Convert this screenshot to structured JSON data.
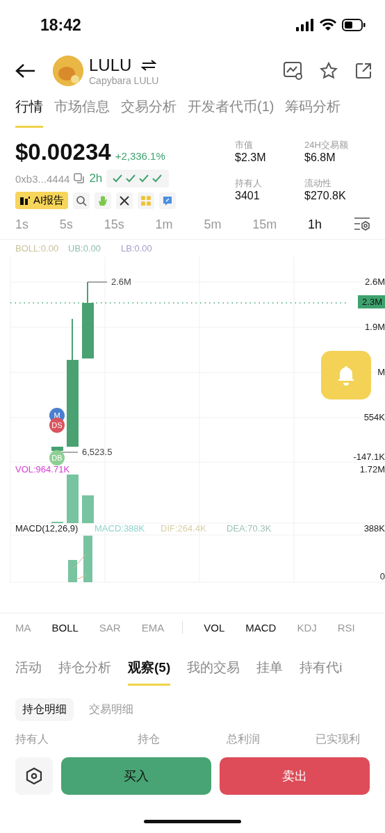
{
  "status_bar": {
    "time": "18:42"
  },
  "header": {
    "symbol": "LULU",
    "name": "Capybara LULU"
  },
  "tabs": [
    {
      "label": "行情",
      "selected": true
    },
    {
      "label": "市场信息",
      "selected": false
    },
    {
      "label": "交易分析",
      "selected": false
    },
    {
      "label": "开发者代币(1)",
      "selected": false
    },
    {
      "label": "筹码分析",
      "selected": false
    }
  ],
  "price": {
    "value": "$0.00234",
    "change": "+2,336.1%",
    "address": "0xb3...4444",
    "age": "2h",
    "ai_report": "AI报告"
  },
  "stats": [
    {
      "label": "市值",
      "value": "$2.3M"
    },
    {
      "label": "24H交易额",
      "value": "$6.8M"
    },
    {
      "label": "持有人",
      "value": "3401"
    },
    {
      "label": "流动性",
      "value": "$270.8K"
    }
  ],
  "intervals": [
    {
      "label": "1s",
      "selected": false
    },
    {
      "label": "5s",
      "selected": false
    },
    {
      "label": "15s",
      "selected": false
    },
    {
      "label": "1m",
      "selected": false
    },
    {
      "label": "5m",
      "selected": false
    },
    {
      "label": "15m",
      "selected": false
    },
    {
      "label": "1h",
      "selected": true
    }
  ],
  "chart": {
    "legend": [
      {
        "text": "BOLL:0.00",
        "color": "#c8c29a"
      },
      {
        "text": "UB:0.00",
        "color": "#8fbfa6"
      },
      {
        "text": "LB:0.00",
        "color": "#a99ccc"
      }
    ],
    "axis_labels": [
      "2.6M",
      "1.9M",
      "M",
      "554K",
      "-147.1K",
      "1.72M"
    ],
    "price_tag": "2.3M",
    "high_label": "2.6M",
    "low_label": "6,523.5",
    "markers": [
      {
        "label": "M",
        "color": "#4a7fd0"
      },
      {
        "label": "DS",
        "color": "#d9545e"
      },
      {
        "label": "DB",
        "color": "#8fcf94"
      }
    ],
    "vol_label": "VOL:964.71K",
    "macd_title": "MACD(12,26,9)",
    "macd_legend": [
      {
        "text": "MACD:388K",
        "color": "#8fd3cc"
      },
      {
        "text": "DIF:264.4K",
        "color": "#d9cfa6"
      },
      {
        "text": "DEA:70.3K",
        "color": "#9fc2b3"
      }
    ],
    "macd_axis": [
      "388K",
      "0"
    ]
  },
  "indicators": [
    {
      "label": "MA",
      "selected": false,
      "divider_before": false
    },
    {
      "label": "BOLL",
      "selected": true,
      "divider_before": false
    },
    {
      "label": "SAR",
      "selected": false,
      "divider_before": false
    },
    {
      "label": "EMA",
      "selected": false,
      "divider_before": false
    },
    {
      "label": "VOL",
      "selected": true,
      "divider_before": true
    },
    {
      "label": "MACD",
      "selected": true,
      "divider_before": false
    },
    {
      "label": "KDJ",
      "selected": false,
      "divider_before": false
    },
    {
      "label": "RSI",
      "selected": false,
      "divider_before": false
    }
  ],
  "bottom_tabs": [
    {
      "label": "活动",
      "selected": false
    },
    {
      "label": "持仓分析",
      "selected": false
    },
    {
      "label": "观察(5)",
      "selected": true
    },
    {
      "label": "我的交易",
      "selected": false
    },
    {
      "label": "挂单",
      "selected": false
    },
    {
      "label": "持有代i",
      "selected": false
    }
  ],
  "sub_tabs": [
    {
      "label": "持仓明细",
      "selected": true
    },
    {
      "label": "交易明细",
      "selected": false
    }
  ],
  "columns": [
    "持有人",
    "持仓",
    "总利润",
    "已实现利"
  ],
  "actions": {
    "buy": "买入",
    "sell": "卖出"
  }
}
